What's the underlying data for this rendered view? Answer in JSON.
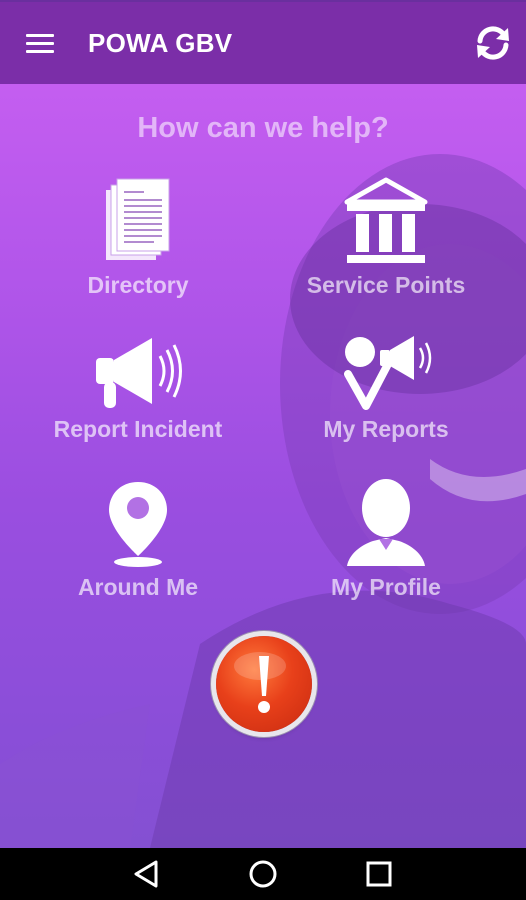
{
  "app": {
    "title": "POWA GBV"
  },
  "main": {
    "heading": "How can we help?",
    "tiles": [
      {
        "label": "Directory",
        "icon": "document-stack-icon"
      },
      {
        "label": "Service Points",
        "icon": "building-icon"
      },
      {
        "label": "Report Incident",
        "icon": "megaphone-icon"
      },
      {
        "label": "My Reports",
        "icon": "person-megaphone-icon"
      },
      {
        "label": "Around Me",
        "icon": "location-pin-icon"
      },
      {
        "label": "My Profile",
        "icon": "user-profile-icon"
      }
    ],
    "sos_symbol": "!"
  },
  "colors": {
    "appbar": "#7b2ea8",
    "accent": "#c45ef0",
    "sos": "#e8401a"
  }
}
